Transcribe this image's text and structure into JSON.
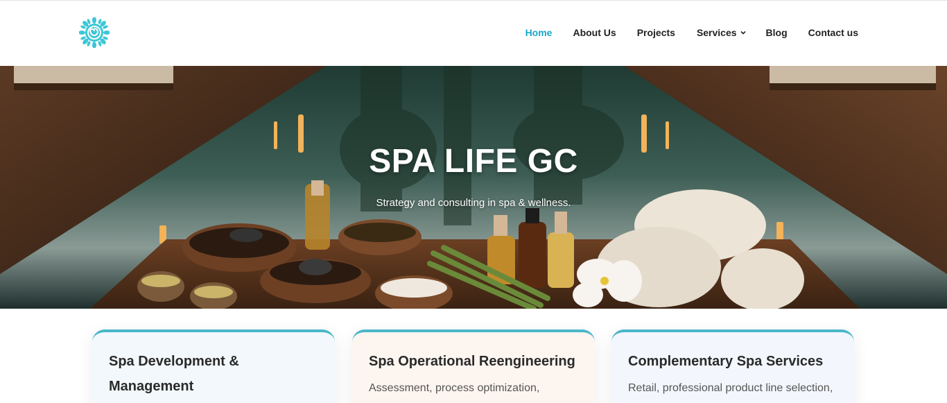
{
  "header": {
    "logo_icon": "lotus-spiral-logo-icon",
    "nav": [
      {
        "label": "Home",
        "active": true
      },
      {
        "label": "About Us",
        "active": false
      },
      {
        "label": "Projects",
        "active": false
      },
      {
        "label": "Services",
        "active": false,
        "has_dropdown": true
      },
      {
        "label": "Blog",
        "active": false
      },
      {
        "label": "Contact us",
        "active": false
      }
    ]
  },
  "hero": {
    "title": "SPA LIFE GC",
    "subtitle": "Strategy and consulting in spa & wellness."
  },
  "cards": [
    {
      "title": "Spa Development & Management",
      "text": ""
    },
    {
      "title": "Spa Operational Reengineering",
      "text": "Assessment, process optimization,"
    },
    {
      "title": "Complementary Spa Services",
      "text": "Retail, professional product line selection,"
    }
  ],
  "colors": {
    "accent": "#1aa7c8",
    "card_border": "#4ab7c9"
  }
}
